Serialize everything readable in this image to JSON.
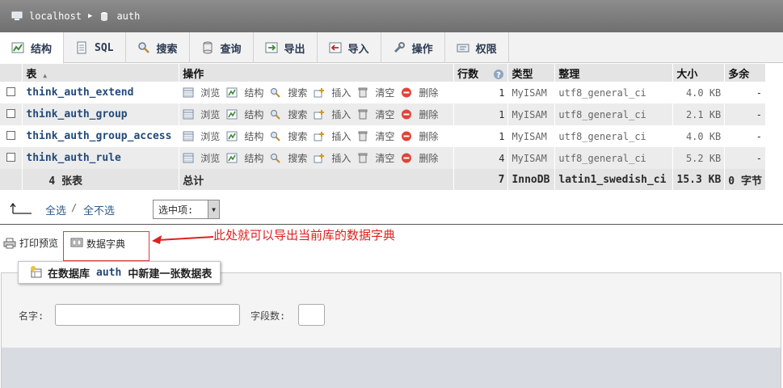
{
  "breadcrumb": {
    "server": "localhost",
    "database": "auth"
  },
  "tabs": [
    {
      "label": "结构",
      "icon": "structure-icon"
    },
    {
      "label": "SQL",
      "icon": "sql-icon"
    },
    {
      "label": "搜索",
      "icon": "search-icon"
    },
    {
      "label": "查询",
      "icon": "query-icon"
    },
    {
      "label": "导出",
      "icon": "export-icon"
    },
    {
      "label": "导入",
      "icon": "import-icon"
    },
    {
      "label": "操作",
      "icon": "wrench-icon"
    },
    {
      "label": "权限",
      "icon": "privileges-icon"
    }
  ],
  "table": {
    "headers": {
      "name": "表",
      "actions": "操作",
      "rows": "行数",
      "type": "类型",
      "collation": "整理",
      "size": "大小",
      "overhead": "多余"
    },
    "actions": [
      "浏览",
      "结构",
      "搜索",
      "插入",
      "清空",
      "删除"
    ],
    "rows": [
      {
        "name": "think_auth_extend",
        "rows": "1",
        "type": "MyISAM",
        "collation": "utf8_general_ci",
        "size": "4.0 KB",
        "overhead": "-"
      },
      {
        "name": "think_auth_group",
        "rows": "1",
        "type": "MyISAM",
        "collation": "utf8_general_ci",
        "size": "2.1 KB",
        "overhead": "-"
      },
      {
        "name": "think_auth_group_access",
        "rows": "1",
        "type": "MyISAM",
        "collation": "utf8_general_ci",
        "size": "4.0 KB",
        "overhead": "-"
      },
      {
        "name": "think_auth_rule",
        "rows": "4",
        "type": "MyISAM",
        "collation": "utf8_general_ci",
        "size": "5.2 KB",
        "overhead": "-"
      }
    ],
    "footer": {
      "count": "4 张表",
      "label": "总计",
      "rows": "7",
      "type": "InnoDB",
      "collation": "latin1_swedish_ci",
      "size": "15.3 KB",
      "overhead": "0 字节"
    }
  },
  "selection": {
    "select_all": "全选",
    "deselect_all": "全不选",
    "with_selected": "选中项:"
  },
  "links": {
    "print": "打印预览",
    "dictionary": "数据字典"
  },
  "annotation": "此处就可以导出当前库的数据字典",
  "create": {
    "prefix": "在数据库",
    "db": "auth",
    "suffix": "中新建一张数据表",
    "name_label": "名字:",
    "fields_label": "字段数:"
  },
  "colors": {
    "accent": "#234a7a",
    "annotation": "#e0201e"
  }
}
